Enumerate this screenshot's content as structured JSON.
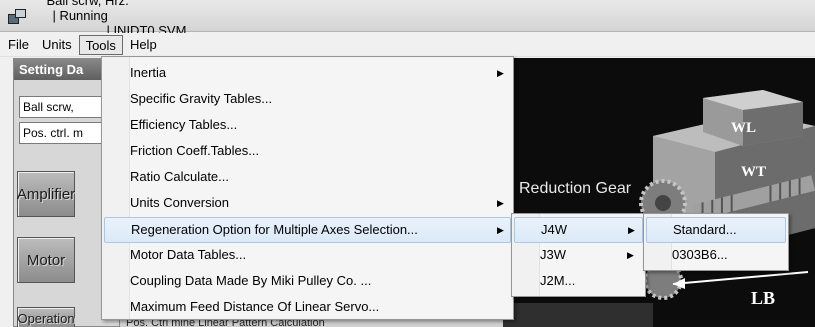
{
  "window": {
    "title_parts": [
      "Ball scrw, Hrz.",
      "| Running",
      "| INIDT0.SVM"
    ],
    "icon": "app-icon"
  },
  "menubar": {
    "items": [
      {
        "label": "File"
      },
      {
        "label": "Units"
      },
      {
        "label": "Tools"
      },
      {
        "label": "Help"
      }
    ]
  },
  "left_panel": {
    "header": "Setting Da",
    "combo1": "Ball scrw,",
    "combo2": "Pos. ctrl. m",
    "buttons": [
      {
        "label": "Amplifier"
      },
      {
        "label": "Motor"
      },
      {
        "label": "Operation"
      }
    ]
  },
  "bottom_strip_text": "Pos. Ctrl mine Linear Pattern          Calculation",
  "view3d": {
    "reduction_label": "Reduction Gear",
    "wl_label": "WL",
    "wt_label": "WT",
    "lb_label": "LB"
  },
  "tools_menu": {
    "items": [
      {
        "label": "Inertia",
        "submenu": true
      },
      {
        "label": "Specific Gravity Tables...",
        "submenu": false
      },
      {
        "label": "Efficiency Tables...",
        "submenu": false
      },
      {
        "label": "Friction Coeff.Tables...",
        "submenu": false
      },
      {
        "label": "Ratio Calculate...",
        "submenu": false
      },
      {
        "label": "Units Conversion",
        "submenu": true
      },
      {
        "label": "Regeneration Option for Multiple Axes Selection...",
        "submenu": true
      },
      {
        "label": "Motor Data Tables...",
        "submenu": false
      },
      {
        "label": "Coupling Data Made By Miki Pulley Co. ...",
        "submenu": false
      },
      {
        "label": "Maximum Feed Distance Of Linear Servo...",
        "submenu": false
      }
    ]
  },
  "regen_submenu": {
    "items": [
      {
        "label": "J4W",
        "submenu": true
      },
      {
        "label": "J3W",
        "submenu": true
      },
      {
        "label": "J2M...",
        "submenu": false
      }
    ]
  },
  "j4w_submenu": {
    "items": [
      {
        "label": "Standard..."
      },
      {
        "label": "0303B6..."
      }
    ]
  }
}
